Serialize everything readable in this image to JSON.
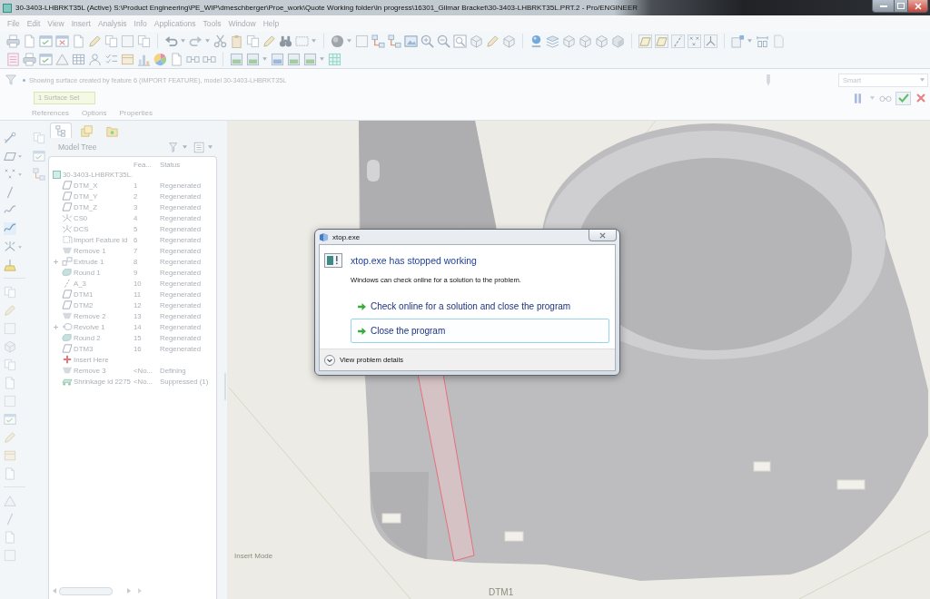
{
  "window": {
    "title": "30-3403-LHBRKT35L (Active) S:\\Product Engineering\\PE_WIP\\dmeschberger\\Proe_work\\Quote Working folder\\In progress\\16301_Gilmar Bracket\\30-3403-LHBRKT35L.PRT.2 - Pro/ENGINEER"
  },
  "menu": [
    {
      "label": "File"
    },
    {
      "label": "Edit"
    },
    {
      "label": "View"
    },
    {
      "label": "Insert"
    },
    {
      "label": "Analysis"
    },
    {
      "label": "Info"
    },
    {
      "label": "Applications"
    },
    {
      "label": "Tools"
    },
    {
      "label": "Window"
    },
    {
      "label": "Help"
    }
  ],
  "dashboard": {
    "message": "Showing surface created by feature 6 (IMPORT FEATURE), model 30-3403-LHBRKT35L",
    "collector": {
      "value": "1 Surface Set"
    },
    "tabs": [
      {
        "label": "References",
        "selected": false
      },
      {
        "label": "Options",
        "selected": false
      },
      {
        "label": "Properties",
        "selected": false
      }
    ],
    "filter": {
      "value": "Smart"
    }
  },
  "model_tree": {
    "panel_tabs": [
      {
        "selected": true
      },
      {
        "selected": false
      },
      {
        "selected": false
      }
    ],
    "title": "Model Tree",
    "columns": [
      "Fea...",
      "Status"
    ],
    "root": {
      "name": "30-3403-LHBRKT35L.",
      "kind": "part",
      "children": [
        {
          "name": "DTM_X",
          "kind": "datum_plane",
          "number": "1",
          "status": "Regenerated",
          "expandable": false
        },
        {
          "name": "DTM_Y",
          "kind": "datum_plane",
          "number": "2",
          "status": "Regenerated",
          "expandable": false
        },
        {
          "name": "DTM_Z",
          "kind": "datum_plane",
          "number": "3",
          "status": "Regenerated",
          "expandable": false
        },
        {
          "name": "CS0",
          "kind": "csys",
          "number": "4",
          "status": "Regenerated",
          "expandable": false
        },
        {
          "name": "DCS",
          "kind": "csys",
          "number": "5",
          "status": "Regenerated",
          "expandable": false
        },
        {
          "name": "Import Feature id",
          "kind": "import",
          "number": "6",
          "status": "Regenerated",
          "expandable": false
        },
        {
          "name": "Remove 1",
          "kind": "remove",
          "number": "7",
          "status": "Regenerated",
          "expandable": false
        },
        {
          "name": "Extrude 1",
          "kind": "extrude",
          "number": "8",
          "status": "Regenerated",
          "expandable": true
        },
        {
          "name": "Round 1",
          "kind": "round",
          "number": "9",
          "status": "Regenerated",
          "expandable": false
        },
        {
          "name": "A_3",
          "kind": "axis",
          "number": "10",
          "status": "Regenerated",
          "expandable": false
        },
        {
          "name": "DTM1",
          "kind": "datum_plane",
          "number": "11",
          "status": "Regenerated",
          "expandable": false
        },
        {
          "name": "DTM2",
          "kind": "datum_plane",
          "number": "12",
          "status": "Regenerated",
          "expandable": false
        },
        {
          "name": "Remove 2",
          "kind": "remove",
          "number": "13",
          "status": "Regenerated",
          "expandable": false
        },
        {
          "name": "Revolve 1",
          "kind": "revolve",
          "number": "14",
          "status": "Regenerated",
          "expandable": true
        },
        {
          "name": "Round 2",
          "kind": "round",
          "number": "15",
          "status": "Regenerated",
          "expandable": false
        },
        {
          "name": "DTM3",
          "kind": "datum_plane",
          "number": "16",
          "status": "Regenerated",
          "expandable": false
        },
        {
          "name": "Insert Here",
          "kind": "insert",
          "expandable": false
        },
        {
          "name": "Remove 3",
          "kind": "remove",
          "number": "<No...",
          "status": "Defining",
          "expandable": false
        },
        {
          "name": "Shrinkage id 2275",
          "kind": "shrinkage",
          "number": "<No...",
          "status": "Suppressed (1)",
          "expandable": false
        }
      ]
    }
  },
  "graphics": {
    "mode_label": "Insert Mode",
    "datum_label": "DTM1"
  },
  "dialog": {
    "title": "xtop.exe",
    "heading": "xtop.exe has stopped working",
    "message": "Windows can check online for a solution to the problem.",
    "options": [
      {
        "label": "Check online for a solution and close the program",
        "selected": false
      },
      {
        "label": "Close the program",
        "selected": true
      }
    ],
    "details": "View problem details"
  }
}
